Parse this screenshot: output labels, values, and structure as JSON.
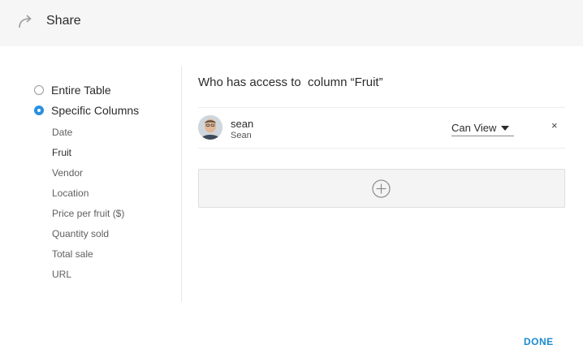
{
  "header": {
    "title": "Share",
    "icon": "share-arrow-icon"
  },
  "scope": {
    "options": [
      {
        "label": "Entire Table",
        "checked": false
      },
      {
        "label": "Specific Columns",
        "checked": true
      }
    ],
    "columns": [
      "Date",
      "Fruit",
      "Vendor",
      "Location",
      "Price per fruit ($)",
      "Quantity sold",
      "Total sale",
      "URL"
    ],
    "active_column": "Fruit"
  },
  "access": {
    "title": "Who has access to  column “Fruit”",
    "users": [
      {
        "username": "sean",
        "display_name": "Sean",
        "permission": "Can View",
        "remove": "×"
      }
    ],
    "add_icon": "plus-circle-icon"
  },
  "footer": {
    "done_label": "DONE"
  },
  "colors": {
    "accent": "#2a8fe0",
    "done": "#1a8ad0",
    "header_bg": "#f6f6f6"
  }
}
